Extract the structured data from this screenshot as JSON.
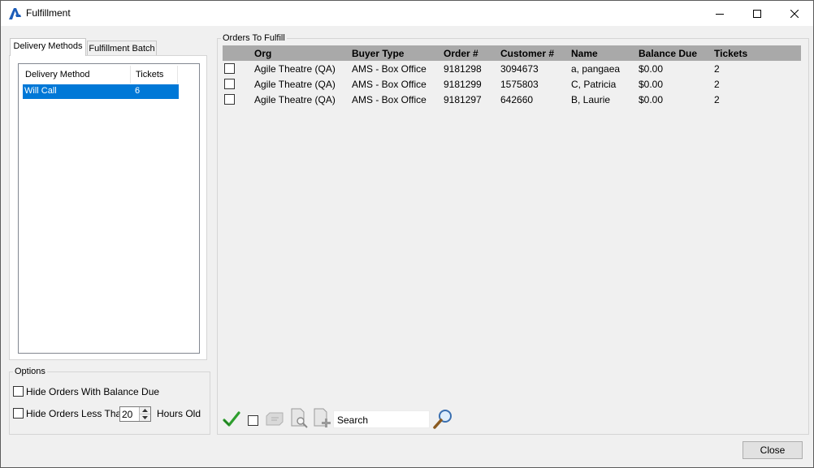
{
  "window": {
    "title": "Fulfillment",
    "accent_color": "#1c5cb8"
  },
  "tabs": [
    {
      "label": "Delivery Methods",
      "active": true
    },
    {
      "label": "Fulfillment Batch",
      "active": false
    }
  ],
  "delivery_list": {
    "columns": [
      "Delivery Method",
      "Tickets"
    ],
    "rows": [
      {
        "method": "Will Call",
        "tickets": "6",
        "selected": true
      }
    ],
    "selection_color": "#0078d7"
  },
  "options": {
    "label": "Options",
    "hide_balance_due": {
      "label": "Hide Orders With Balance Due",
      "checked": false
    },
    "hide_less_than": {
      "label": "Hide Orders Less Than",
      "checked": false
    },
    "hours_value": "20",
    "hours_suffix": "Hours Old"
  },
  "orders": {
    "label": "Orders To Fulfill",
    "header_color": "#a9a9a9",
    "columns": [
      "Org",
      "Buyer Type",
      "Order #",
      "Customer #",
      "Name",
      "Balance Due",
      "Tickets"
    ],
    "rows": [
      {
        "org": "Agile Theatre (QA)",
        "buyer_type": "AMS - Box Office",
        "order": "9181298",
        "customer": "3094673",
        "name": "a, pangaea",
        "balance": "$0.00",
        "tickets": "2"
      },
      {
        "org": "Agile Theatre (QA)",
        "buyer_type": "AMS - Box Office",
        "order": "9181299",
        "customer": "1575803",
        "name": "C, Patricia",
        "balance": "$0.00",
        "tickets": "2"
      },
      {
        "org": "Agile Theatre (QA)",
        "buyer_type": "AMS - Box Office",
        "order": "9181297",
        "customer": "642660",
        "name": "B, Laurie",
        "balance": "$0.00",
        "tickets": "2"
      }
    ]
  },
  "toolbar": {
    "icons": [
      "green-checkmark-icon",
      "checkbox-icon",
      "ticket-icon",
      "document-search-icon",
      "document-add-icon",
      "magnifier-icon"
    ],
    "search_placeholder": "Search"
  },
  "footer": {
    "close_label": "Close"
  }
}
